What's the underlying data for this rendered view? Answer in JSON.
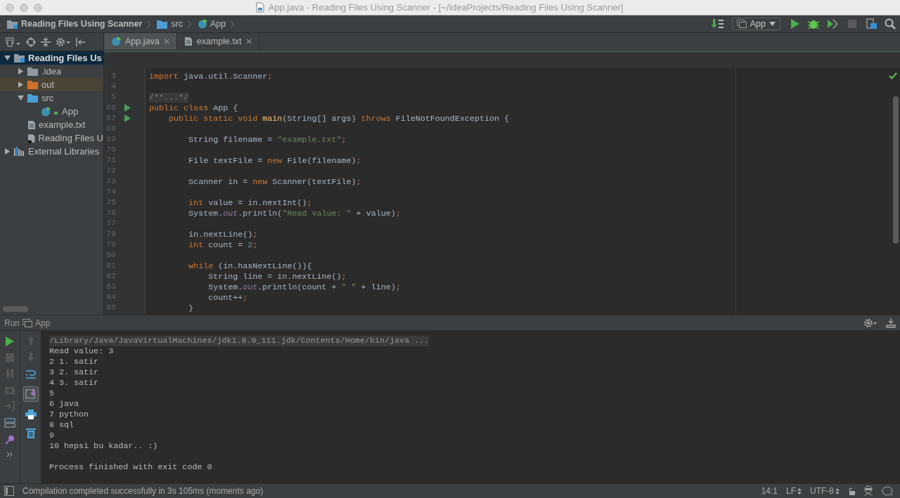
{
  "window": {
    "title": "App.java - Reading Files Using Scanner - [~/IdeaProjects/Reading Files Using Scanner]"
  },
  "navbar": {
    "crumbs": [
      {
        "label": "Reading Files Using Scanner",
        "kind": "project"
      },
      {
        "label": "src",
        "kind": "folder"
      },
      {
        "label": "App",
        "kind": "class"
      }
    ],
    "run_config": "App"
  },
  "project_tree": [
    {
      "label": "Reading Files Us",
      "kind": "project",
      "expanded": true,
      "selected": true,
      "children": [
        {
          "label": ".idea",
          "kind": "folder",
          "expanded": false,
          "selected": false
        },
        {
          "label": "out",
          "kind": "excluded",
          "expanded": false,
          "selected": false
        },
        {
          "label": "src",
          "kind": "source",
          "expanded": true,
          "selected": false,
          "children": [
            {
              "label": "App",
              "kind": "class",
              "selected": false
            }
          ]
        },
        {
          "label": "example.txt",
          "kind": "text",
          "selected": false
        },
        {
          "label": "Reading Files U",
          "kind": "module",
          "selected": false
        }
      ]
    },
    {
      "label": "External Libraries",
      "kind": "libraries",
      "expanded": false,
      "selected": false
    }
  ],
  "tabs": [
    {
      "label": "App.java",
      "kind": "class",
      "selected": true
    },
    {
      "label": "example.txt",
      "kind": "text",
      "selected": false
    }
  ],
  "code": [
    {
      "n": "3",
      "run": false,
      "t": [
        {
          "kind": "kw",
          "s": "import "
        },
        {
          "kind": "p",
          "s": "java.util.Scanner"
        },
        {
          "kind": "kw",
          "s": ";"
        }
      ]
    },
    {
      "n": "4",
      "run": false
    },
    {
      "n": "5",
      "run": false,
      "t": [
        {
          "kind": "fold",
          "s": "/**...*/"
        }
      ]
    },
    {
      "n": "66",
      "run": true,
      "t": [
        {
          "kind": "kw",
          "s": "public class "
        },
        {
          "kind": "p",
          "s": "App {"
        }
      ]
    },
    {
      "n": "67",
      "run": true,
      "t": [
        {
          "kind": "kw",
          "s": "    public static void "
        },
        {
          "kind": "fn",
          "s": "main"
        },
        {
          "kind": "p",
          "s": "(String[] args) "
        },
        {
          "kind": "kw",
          "s": "throws "
        },
        {
          "kind": "p",
          "s": "FileNotFoundException {"
        }
      ]
    },
    {
      "n": "68",
      "run": false
    },
    {
      "n": "69",
      "run": false,
      "t": [
        {
          "kind": "p",
          "s": "        String filename = "
        },
        {
          "kind": "str",
          "s": "\"example.txt\""
        },
        {
          "kind": "kw",
          "s": ";"
        }
      ]
    },
    {
      "n": "70",
      "run": false
    },
    {
      "n": "71",
      "run": false,
      "t": [
        {
          "kind": "p",
          "s": "        File textFile = "
        },
        {
          "kind": "kw",
          "s": "new "
        },
        {
          "kind": "p",
          "s": "File(filename)"
        },
        {
          "kind": "kw",
          "s": ";"
        }
      ]
    },
    {
      "n": "72",
      "run": false
    },
    {
      "n": "73",
      "run": false,
      "t": [
        {
          "kind": "p",
          "s": "        Scanner in = "
        },
        {
          "kind": "kw",
          "s": "new "
        },
        {
          "kind": "p",
          "s": "Scanner(textFile)"
        },
        {
          "kind": "kw",
          "s": ";"
        }
      ]
    },
    {
      "n": "74",
      "run": false
    },
    {
      "n": "75",
      "run": false,
      "t": [
        {
          "kind": "kw",
          "s": "        int "
        },
        {
          "kind": "p",
          "s": "value = in.nextInt()"
        },
        {
          "kind": "kw",
          "s": ";"
        }
      ]
    },
    {
      "n": "76",
      "run": false,
      "t": [
        {
          "kind": "p",
          "s": "        System."
        },
        {
          "kind": "field",
          "s": "out"
        },
        {
          "kind": "p",
          "s": ".println("
        },
        {
          "kind": "str",
          "s": "\"Read value: \""
        },
        {
          "kind": "p",
          "s": " + value)"
        },
        {
          "kind": "kw",
          "s": ";"
        }
      ]
    },
    {
      "n": "77",
      "run": false
    },
    {
      "n": "78",
      "run": false,
      "t": [
        {
          "kind": "p",
          "s": "        in.nextLine()"
        },
        {
          "kind": "kw",
          "s": ";"
        }
      ]
    },
    {
      "n": "79",
      "run": false,
      "t": [
        {
          "kind": "kw",
          "s": "        int "
        },
        {
          "kind": "p",
          "s": "count = "
        },
        {
          "kind": "num",
          "s": "2"
        },
        {
          "kind": "kw",
          "s": ";"
        }
      ]
    },
    {
      "n": "80",
      "run": false
    },
    {
      "n": "81",
      "run": false,
      "t": [
        {
          "kind": "kw",
          "s": "        while "
        },
        {
          "kind": "p",
          "s": "(in.hasNextLine()){"
        }
      ]
    },
    {
      "n": "82",
      "run": false,
      "t": [
        {
          "kind": "p",
          "s": "            String line = in.nextLine()"
        },
        {
          "kind": "kw",
          "s": ";"
        }
      ]
    },
    {
      "n": "83",
      "run": false,
      "t": [
        {
          "kind": "p",
          "s": "            System."
        },
        {
          "kind": "field",
          "s": "out"
        },
        {
          "kind": "p",
          "s": ".println(count + "
        },
        {
          "kind": "str",
          "s": "\" \""
        },
        {
          "kind": "p",
          "s": " + line)"
        },
        {
          "kind": "kw",
          "s": ";"
        }
      ]
    },
    {
      "n": "84",
      "run": false,
      "t": [
        {
          "kind": "p",
          "s": "            count++"
        },
        {
          "kind": "kw",
          "s": ";"
        }
      ]
    },
    {
      "n": "85",
      "run": false,
      "t": [
        {
          "kind": "p",
          "s": "        }"
        }
      ]
    }
  ],
  "run_panel": {
    "label": "Run",
    "config": "App"
  },
  "console": [
    {
      "kind": "command",
      "text": "/Library/Java/JavaVirtualMachines/jdk1.8.0_111.jdk/Contents/Home/bin/java ..."
    },
    {
      "kind": "out",
      "text": "Read value: 3"
    },
    {
      "kind": "out",
      "text": "2 1. satir"
    },
    {
      "kind": "out",
      "text": "3 2. satir"
    },
    {
      "kind": "out",
      "text": "4 3. satir"
    },
    {
      "kind": "out",
      "text": "5"
    },
    {
      "kind": "out",
      "text": "6 java"
    },
    {
      "kind": "out",
      "text": "7 python"
    },
    {
      "kind": "out",
      "text": "8 sql"
    },
    {
      "kind": "out",
      "text": "9"
    },
    {
      "kind": "out",
      "text": "10 hepsi bu kadar.. :)"
    },
    {
      "kind": "exit",
      "text": "Process finished with exit code 0"
    }
  ],
  "status_bar": {
    "message": "Compilation completed successfully in 3s 105ms (moments ago)",
    "position": "14:1",
    "line_sep": "LF",
    "encoding": "UTF-8"
  }
}
